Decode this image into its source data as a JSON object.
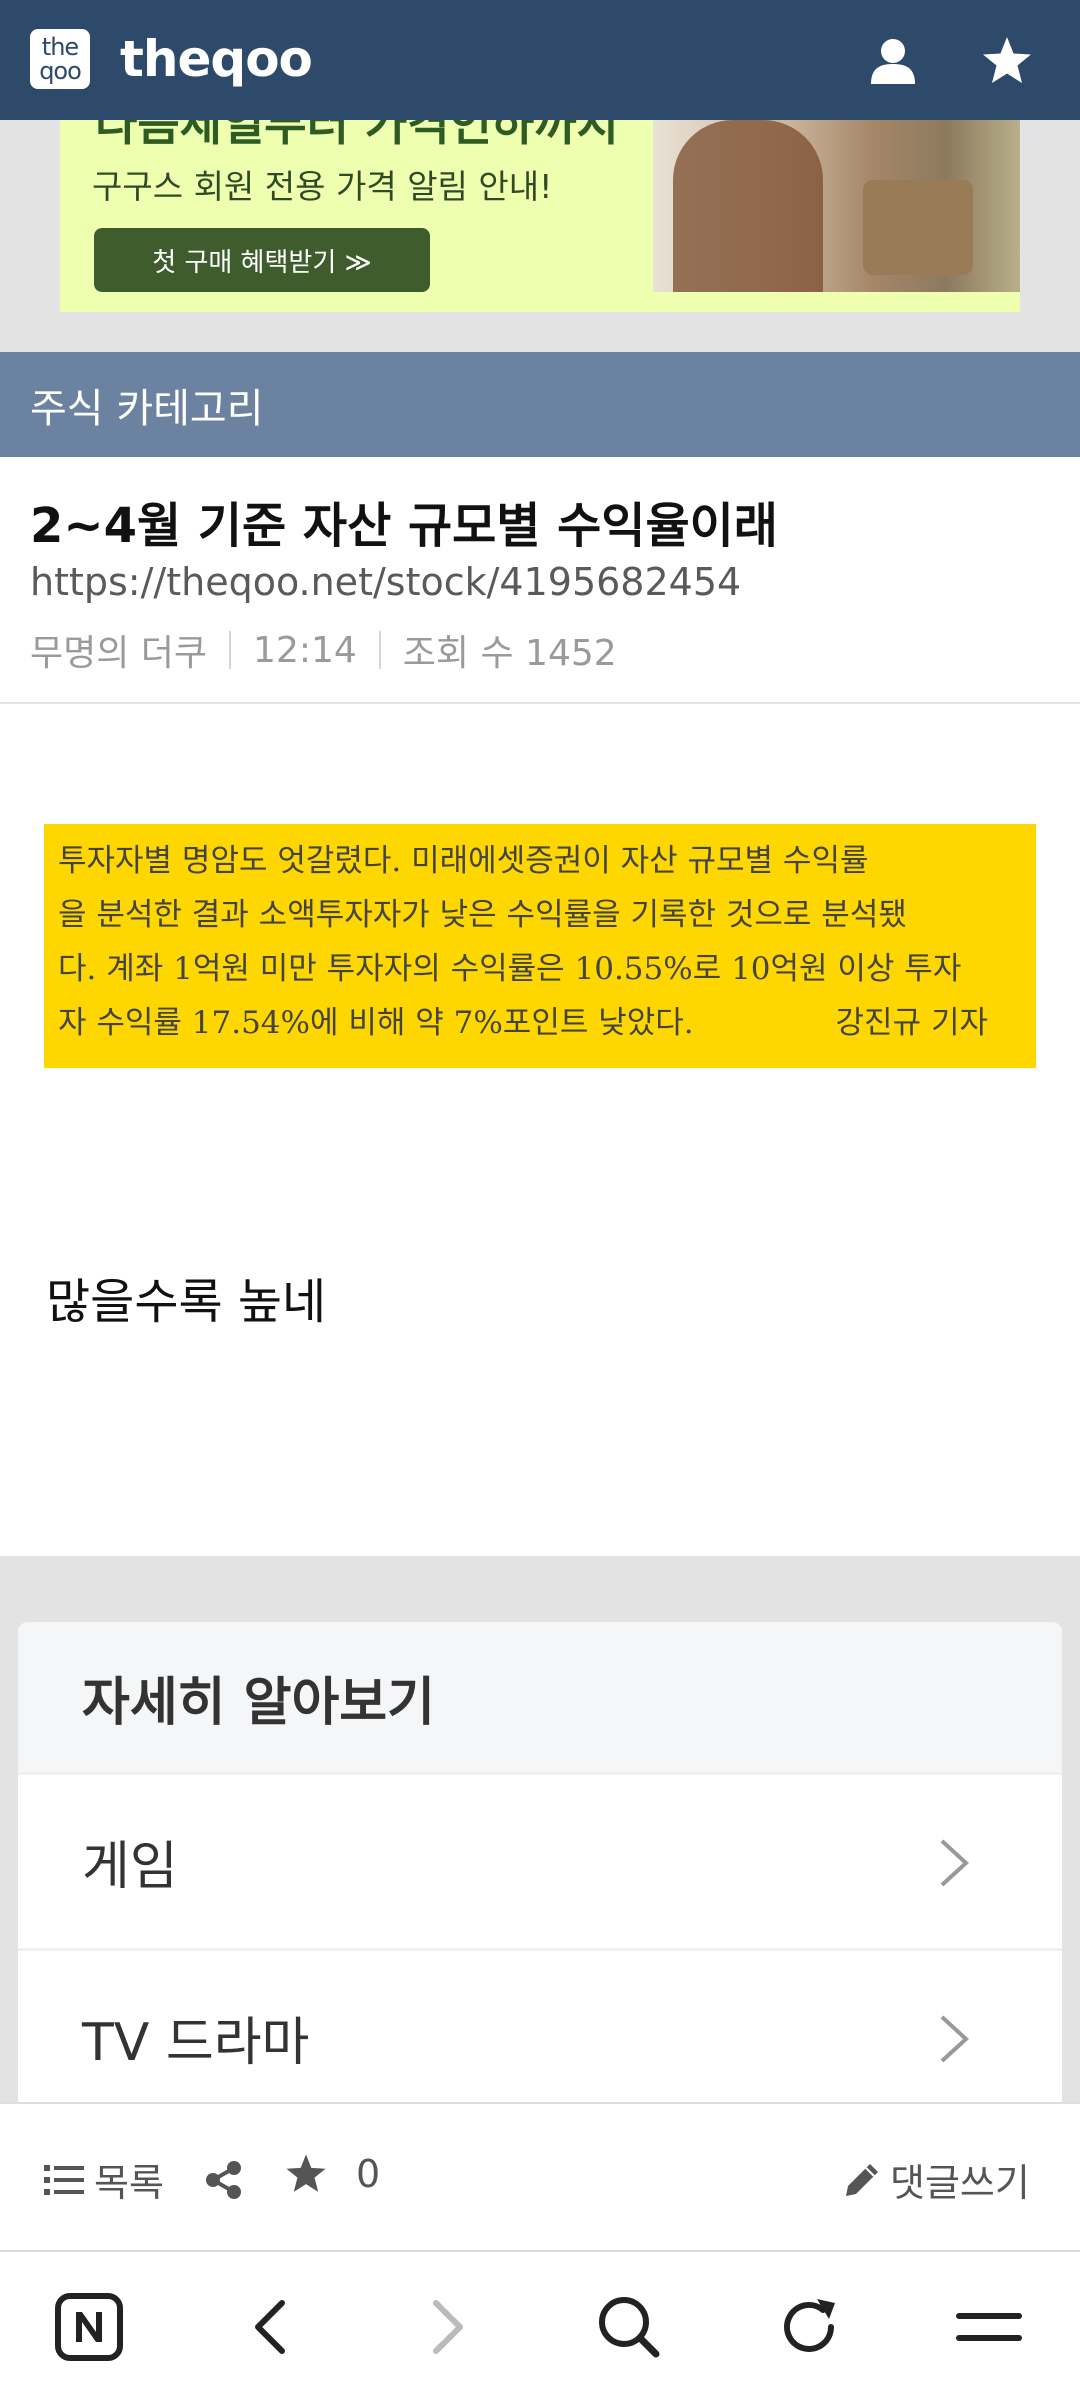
{
  "app": {
    "logo_text_top": "the",
    "logo_text_bottom": "qoo",
    "brand_name": "theqoo"
  },
  "ad": {
    "headline": "다음세일부터 가격인하까지",
    "subtext": "구구스 회원 전용 가격 알림 안내!",
    "button_label": "첫 구매 혜택받기 ≫"
  },
  "category": {
    "label": "주식 카테고리"
  },
  "post": {
    "title": "2~4월 기준 자산 규모별 수익율이래",
    "url": "https://theqoo.net/stock/4195682454",
    "author": "무명의 더쿠",
    "time": "12:14",
    "views": "조회 수 1452",
    "clipping_lines": [
      "투자자별 명암도 엇갈렸다. 미래에셋증권이 자산 규모별 수익률",
      "을 분석한 결과 소액투자자가 낮은 수익률을 기록한 것으로 분석됐",
      "다. 계좌 1억원 미만 투자자의 수익률은 10.55%로 10억원 이상 투자",
      "자 수익률 17.54%에 비해 약 7%포인트 낮았다."
    ],
    "clipping_reporter": "강진규 기자",
    "body": "많을수록 높네"
  },
  "learn_more": {
    "heading": "자세히 알아보기",
    "items": [
      {
        "label": "게임"
      },
      {
        "label": "TV 드라마"
      }
    ]
  },
  "post_toolbar": {
    "list_label": "목록",
    "favorite_count": "0",
    "comment_label": "댓글쓰기"
  },
  "colors": {
    "header_bg": "#2d4a6b",
    "category_bg": "#6b82a0",
    "clipping_bg": "#ffd700",
    "ad_bg": "#eeffb0",
    "ad_button_bg": "#3f5d2c"
  },
  "icons": {
    "top_right": [
      "user-icon",
      "star-icon"
    ],
    "toolbar": [
      "list-icon",
      "share-icon",
      "star-icon",
      "pencil-icon"
    ],
    "browser": [
      "naver-n-icon",
      "back-icon",
      "forward-icon",
      "search-icon",
      "refresh-icon",
      "menu-icon"
    ]
  }
}
